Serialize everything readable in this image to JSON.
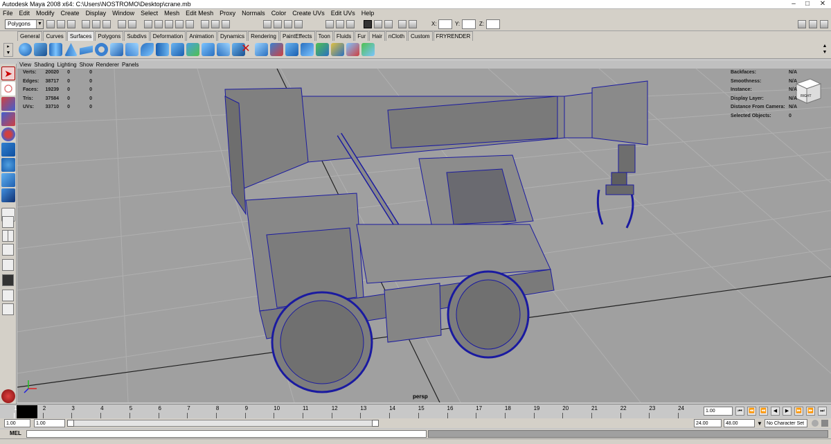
{
  "window": {
    "title": "Autodesk Maya 2008 x64: C:\\Users\\NOSTROMO\\Desktop\\crane.mb",
    "min": "–",
    "max": "□",
    "close": "✕"
  },
  "menu": [
    "File",
    "Edit",
    "Modify",
    "Create",
    "Display",
    "Window",
    "Select",
    "Mesh",
    "Edit Mesh",
    "Proxy",
    "Normals",
    "Color",
    "Create UVs",
    "Edit UVs",
    "Help"
  ],
  "status_line": {
    "mode": "Polygons",
    "x_label": "X:",
    "y_label": "Y:",
    "z_label": "Z:"
  },
  "shelf_tabs": [
    "General",
    "Curves",
    "Surfaces",
    "Polygons",
    "Subdivs",
    "Deformation",
    "Animation",
    "Dynamics",
    "Rendering",
    "PaintEffects",
    "Toon",
    "Fluids",
    "Fur",
    "Hair",
    "nCloth",
    "Custom",
    "FRYRENDER"
  ],
  "active_shelf_tab": "Surfaces",
  "panel_menu": [
    "View",
    "Shading",
    "Lighting",
    "Show",
    "Renderer",
    "Panels"
  ],
  "hud_left": [
    {
      "label": "Verts:",
      "v1": "20020",
      "v2": "0",
      "v3": "0"
    },
    {
      "label": "Edges:",
      "v1": "38717",
      "v2": "0",
      "v3": "0"
    },
    {
      "label": "Faces:",
      "v1": "19239",
      "v2": "0",
      "v3": "0"
    },
    {
      "label": "Tris:",
      "v1": "37584",
      "v2": "0",
      "v3": "0"
    },
    {
      "label": "UVs:",
      "v1": "33710",
      "v2": "0",
      "v3": "0"
    }
  ],
  "hud_right": [
    {
      "label": "Backfaces:",
      "value": "N/A"
    },
    {
      "label": "Smoothness:",
      "value": "N/A"
    },
    {
      "label": "Instance:",
      "value": "N/A"
    },
    {
      "label": "Display Layer:",
      "value": "N/A"
    },
    {
      "label": "Distance From Camera:",
      "value": "N/A"
    },
    {
      "label": "Selected Objects:",
      "value": "0"
    }
  ],
  "view_cube_label": "RIGHT",
  "camera": "persp",
  "time_ticks": [
    "1",
    "2",
    "3",
    "4",
    "5",
    "6",
    "7",
    "8",
    "9",
    "10",
    "11",
    "12",
    "13",
    "14",
    "15",
    "16",
    "17",
    "18",
    "19",
    "20",
    "21",
    "22",
    "23",
    "24"
  ],
  "current_frame": "1.00",
  "range": {
    "start": "1.00",
    "playback_start": "1.00",
    "playback_end": "24.00",
    "end": "48.00",
    "character_set": "No Character Set"
  },
  "command_line": {
    "label": "MEL"
  },
  "playback_buttons": [
    "⏮",
    "⏪",
    "◀",
    "▶",
    "⏩",
    "⏭"
  ]
}
